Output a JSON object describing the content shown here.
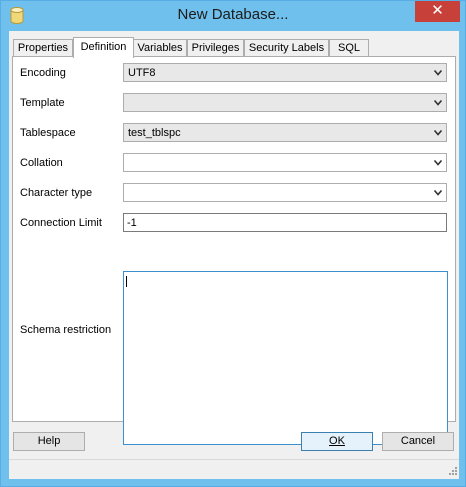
{
  "window": {
    "title": "New Database...",
    "close_glyph": "✕"
  },
  "tabs": [
    {
      "label": "Properties"
    },
    {
      "label": "Definition"
    },
    {
      "label": "Variables"
    },
    {
      "label": "Privileges"
    },
    {
      "label": "Security Labels"
    },
    {
      "label": "SQL"
    }
  ],
  "active_tab": "Definition",
  "form": {
    "encoding": {
      "label": "Encoding",
      "value": "UTF8"
    },
    "template": {
      "label": "Template",
      "value": ""
    },
    "tablespace": {
      "label": "Tablespace",
      "value": "test_tblspc"
    },
    "collation": {
      "label": "Collation",
      "value": ""
    },
    "character_type": {
      "label": "Character type",
      "value": ""
    },
    "connection_limit": {
      "label": "Connection Limit",
      "value": "-1"
    },
    "schema_restriction": {
      "label": "Schema restriction",
      "value": ""
    }
  },
  "buttons": {
    "help": "Help",
    "ok": "OK",
    "cancel": "Cancel"
  },
  "icons": {
    "app": "database-icon",
    "close": "close-icon",
    "dropdown": "chevron-down-icon",
    "grip": "resize-grip-icon"
  },
  "colors": {
    "titlebar": "#6fc0ec",
    "close_button": "#c7403a",
    "focus_border": "#3d8fcd"
  }
}
